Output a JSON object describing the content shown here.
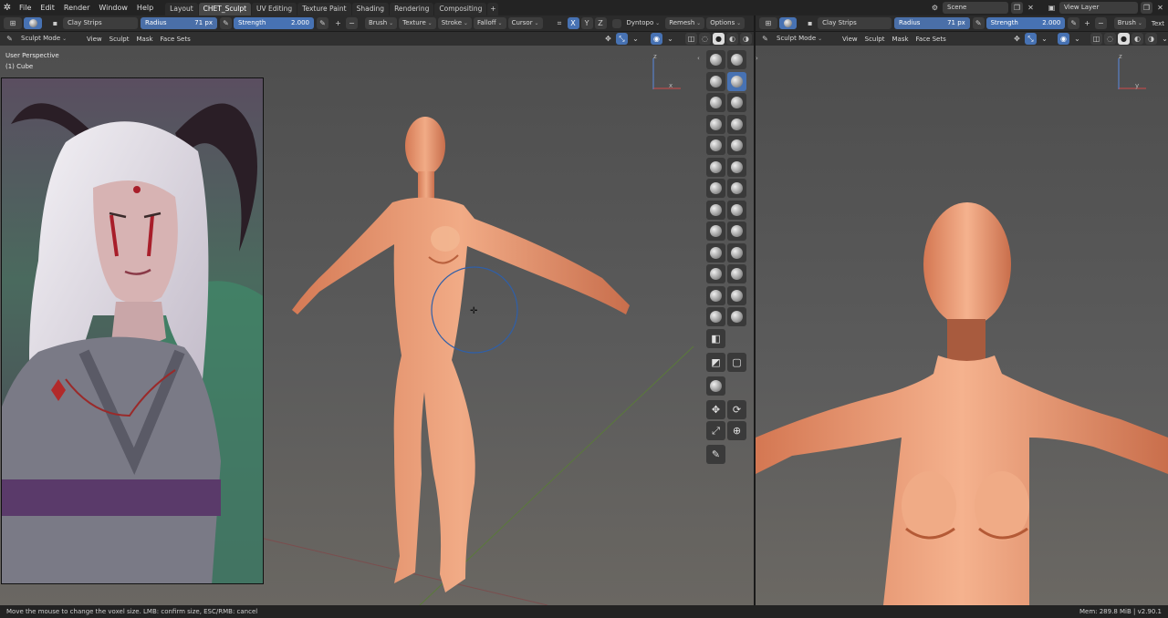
{
  "topbar": {
    "menus": [
      "File",
      "Edit",
      "Render",
      "Window",
      "Help"
    ],
    "tabs": [
      "Layout",
      "CHET_Sculpt",
      "UV Editing",
      "Texture Paint",
      "Shading",
      "Rendering",
      "Compositing"
    ],
    "add_tab": "+",
    "scene_label": "Scene",
    "view_layer_label": "View Layer"
  },
  "tool_header": {
    "brush_name": "Clay Strips",
    "radius_label": "Radius",
    "radius_value": "71 px",
    "strength_label": "Strength",
    "strength_value": "2.000",
    "plus": "+",
    "minus": "−",
    "dropdowns": [
      "Brush",
      "Texture",
      "Stroke",
      "Falloff",
      "Cursor"
    ],
    "axes": [
      "X",
      "Y",
      "Z"
    ],
    "dyntopo": "Dyntopo",
    "remesh": "Remesh",
    "options": "Options"
  },
  "right_tool_header": {
    "brush_name": "Clay Strips",
    "radius_label": "Radius",
    "radius_value": "71 px",
    "strength_label": "Strength",
    "strength_value": "2.000",
    "brush": "Brush",
    "texture_cut": "Text"
  },
  "mode_bar": {
    "mode": "Sculpt Mode",
    "menus": [
      "View",
      "Sculpt",
      "Mask",
      "Face Sets"
    ]
  },
  "viewport": {
    "perspective": "User Perspective",
    "object": "(1) Cube",
    "axis_z": "z",
    "axis_x": "x",
    "axis_y": "y"
  },
  "sculpt_tools": [
    "draw",
    "draw-sharp",
    "clay",
    "clay-strips",
    "clay-thumb",
    "layer",
    "inflate",
    "blob",
    "crease",
    "smooth",
    "flatten",
    "fill",
    "scrape",
    "multiplane-scrape",
    "pinch",
    "grab",
    "elastic-deform",
    "snake-hook",
    "thumb",
    "pose",
    "nudge",
    "rotate",
    "slide-relax",
    "boundary",
    "cloth",
    "simplify",
    "mask",
    "draw-face-sets",
    "box-mask",
    "box-hide",
    "mesh-filter",
    "move",
    "rotate-gizmo",
    "scale",
    "transform",
    "annotate"
  ],
  "status": {
    "left": "Move the mouse to change the voxel size. LMB: confirm size, ESC/RMB: cancel",
    "right": "Mem: 289.8 MiB | v2.90.1"
  },
  "colors": {
    "accent": "#4772b3",
    "skin": "#e8a07a",
    "brush_circle": "#2f5fa8"
  }
}
